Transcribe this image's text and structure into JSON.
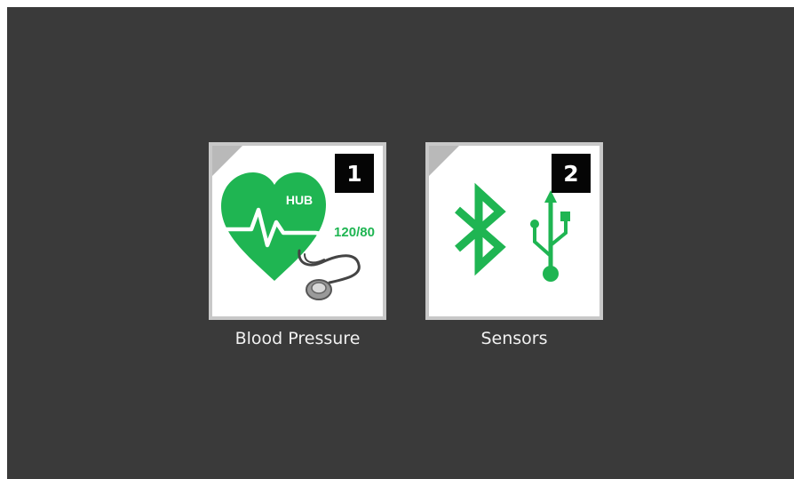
{
  "colors": {
    "background": "#3a3a3a",
    "tile_face": "#ffffff",
    "tile_border": "#c8c8c8",
    "badge": "#050505",
    "accent_green": "#1fb552",
    "label_text": "#f1f1f1"
  },
  "apps": [
    {
      "number": "1",
      "label": "Blood Pressure",
      "icon": "heart-stethoscope-icon",
      "icon_text_hub": "HUB",
      "icon_text_reading": "120/80"
    },
    {
      "number": "2",
      "label": "Sensors",
      "icon": "bluetooth-usb-icon"
    }
  ]
}
